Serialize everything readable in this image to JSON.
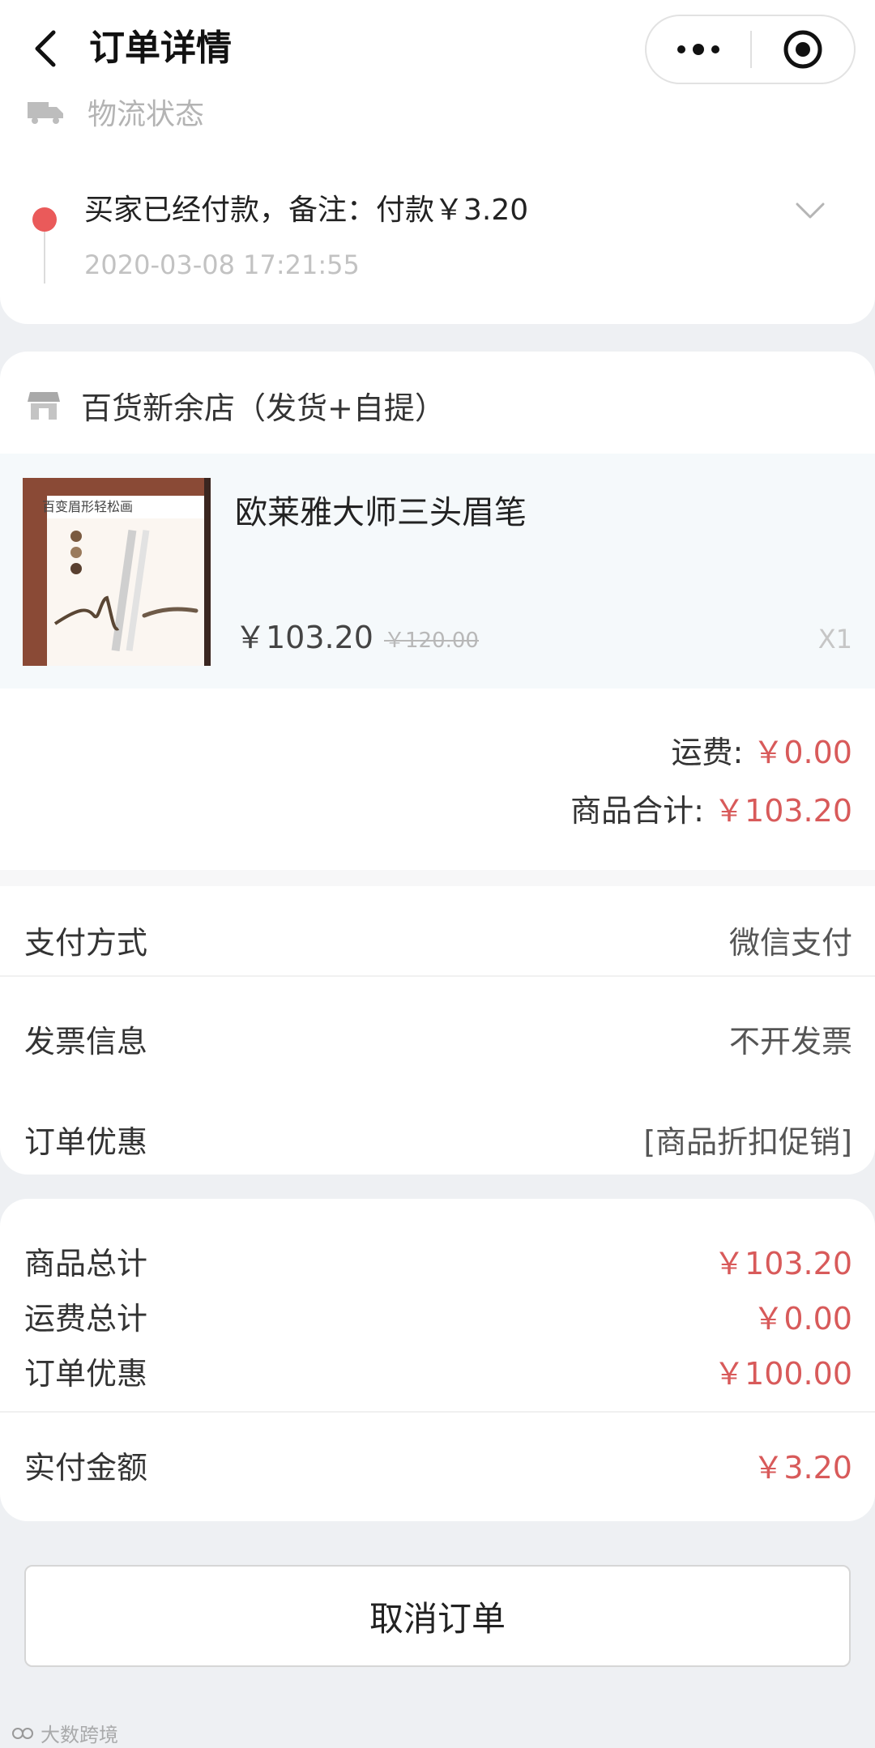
{
  "nav": {
    "title": "订单详情"
  },
  "logistics": {
    "header": "物流状态",
    "status": "买家已经付款，备注：付款￥3.20",
    "time": "2020-03-08 17:21:55"
  },
  "shop": {
    "name": "百货新余店（发货+自提）",
    "product": {
      "name": "欧莱雅大师三头眉笔",
      "price": "￥103.20",
      "original_price": "￥120.00",
      "quantity": "X1",
      "image_caption": "百变眉形轻松画"
    },
    "shipping": {
      "label": "运费:",
      "value": "￥0.00"
    },
    "subtotal": {
      "label": "商品合计:",
      "value": "￥103.20"
    },
    "info_rows": [
      {
        "label": "支付方式",
        "value": "微信支付"
      },
      {
        "label": "发票信息",
        "value": "不开发票"
      },
      {
        "label": "订单优惠",
        "value": "[商品折扣促销]"
      }
    ]
  },
  "totals": {
    "rows": [
      {
        "label": "商品总计",
        "value": "￥103.20"
      },
      {
        "label": "运费总计",
        "value": "￥0.00"
      },
      {
        "label": "订单优惠",
        "value": "￥100.00"
      }
    ],
    "paid": {
      "label": "实付金额",
      "value": "￥3.20"
    }
  },
  "actions": {
    "cancel_label": "取消订单"
  },
  "watermark": "大数跨境",
  "colors": {
    "accent_red": "#d85a5a",
    "status_dot": "#ea5a5a"
  }
}
